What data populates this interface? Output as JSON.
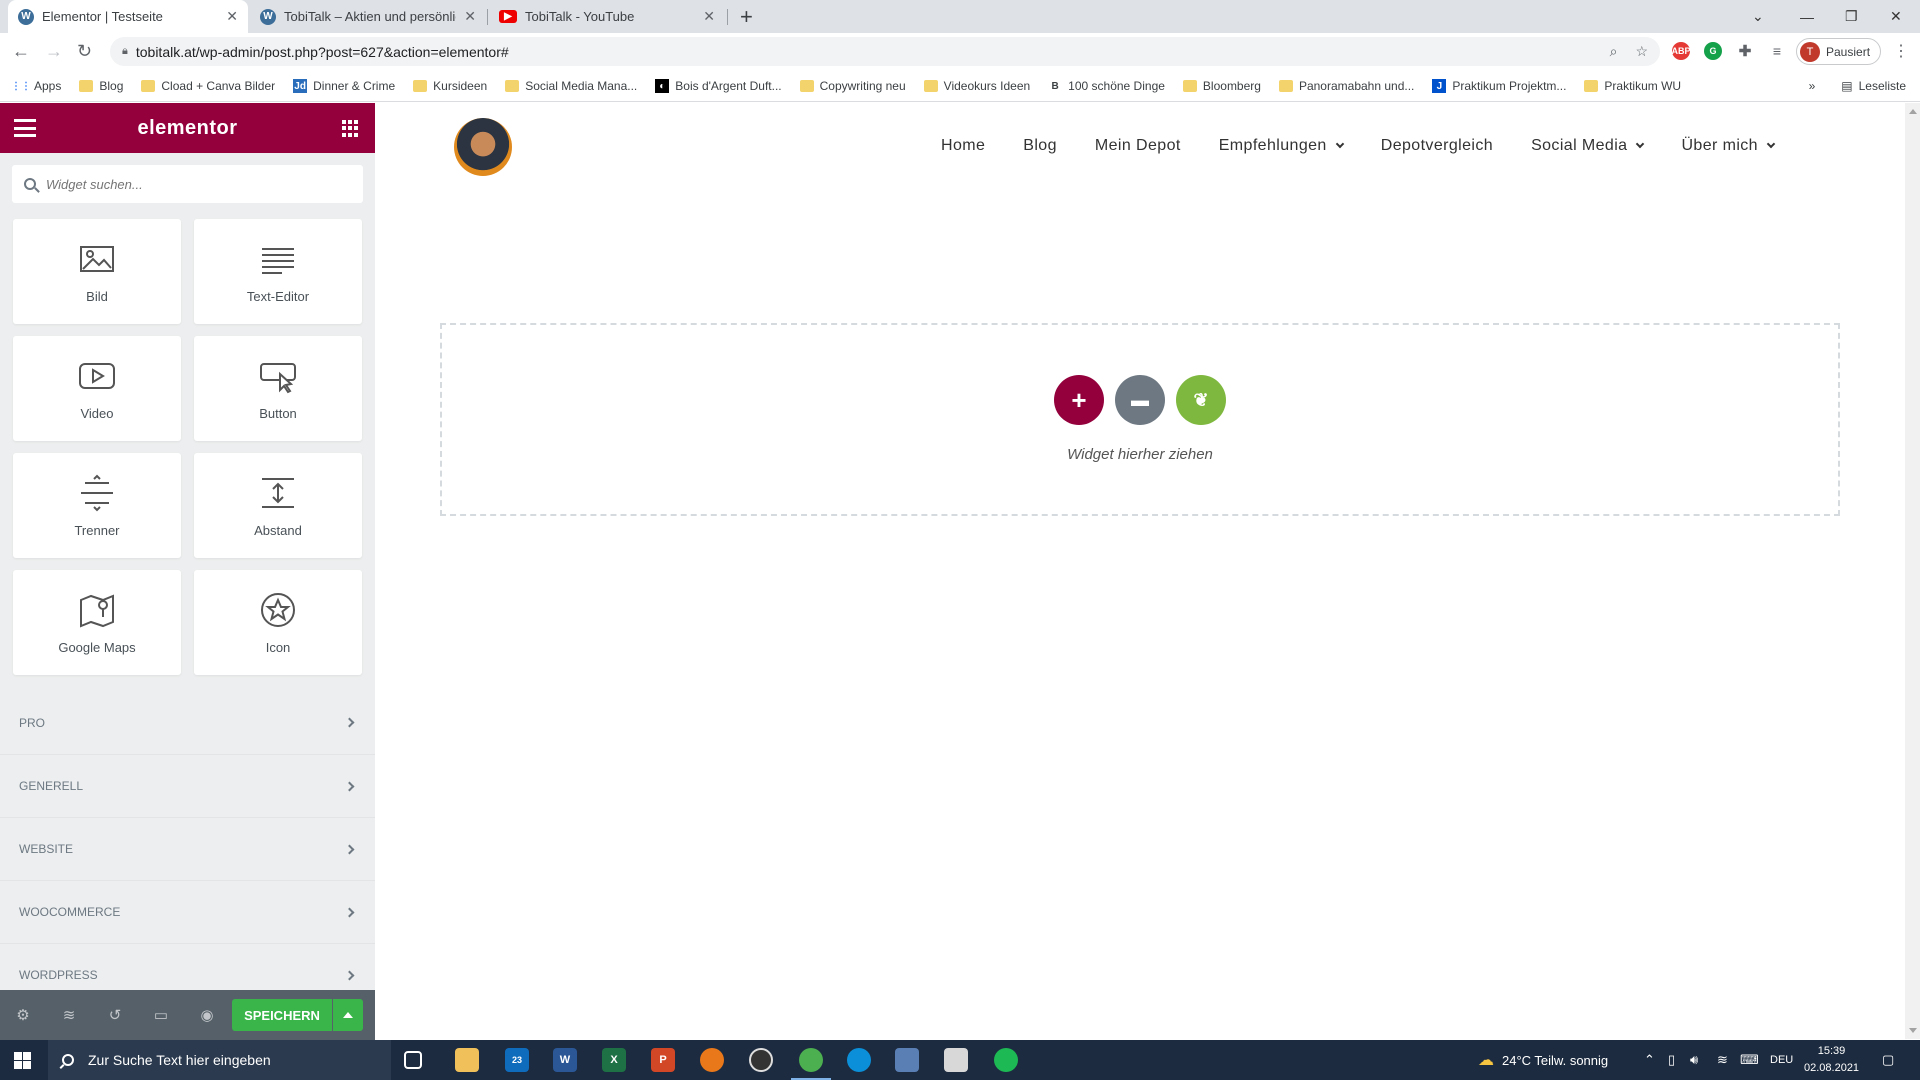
{
  "browser": {
    "tabs": [
      {
        "title": "Elementor | Testseite",
        "icon": "wordpress-icon"
      },
      {
        "title": "TobiTalk – Aktien und persönliche",
        "icon": "wordpress-icon"
      },
      {
        "title": "TobiTalk - YouTube",
        "icon": "youtube-icon"
      }
    ],
    "url": "tobitalk.at/wp-admin/post.php?post=627&action=elementor#",
    "profile_initial": "T",
    "profile_label": "Pausiert",
    "bookmarks": [
      "Apps",
      "Blog",
      "Cload + Canva Bilder",
      "Dinner & Crime",
      "Kursideen",
      "Social Media Mana...",
      "Bois d'Argent Duft...",
      "Copywriting neu",
      "Videokurs Ideen",
      "100 schöne Dinge",
      "Bloomberg",
      "Panoramabahn und...",
      "Praktikum Projektm...",
      "Praktikum WU"
    ],
    "reading_list": "Leseliste"
  },
  "panel": {
    "brand": "elementor",
    "search_placeholder": "Widget suchen...",
    "widgets": [
      {
        "label": "Bild",
        "icon": "image-icon"
      },
      {
        "label": "Text-Editor",
        "icon": "text-editor-icon"
      },
      {
        "label": "Video",
        "icon": "video-icon"
      },
      {
        "label": "Button",
        "icon": "button-icon"
      },
      {
        "label": "Trenner",
        "icon": "divider-icon"
      },
      {
        "label": "Abstand",
        "icon": "spacer-icon"
      },
      {
        "label": "Google Maps",
        "icon": "map-icon"
      },
      {
        "label": "Icon",
        "icon": "star-icon"
      }
    ],
    "categories": [
      "PRO",
      "GENERELL",
      "WEBSITE",
      "WOOCOMMERCE",
      "WORDPRESS"
    ],
    "save_label": "SPEICHERN",
    "accent": "#93003c",
    "save_color": "#39b54a"
  },
  "preview": {
    "menu": [
      {
        "label": "Home",
        "dropdown": false
      },
      {
        "label": "Blog",
        "dropdown": false
      },
      {
        "label": "Mein Depot",
        "dropdown": false
      },
      {
        "label": "Empfehlungen",
        "dropdown": true
      },
      {
        "label": "Depotvergleich",
        "dropdown": false
      },
      {
        "label": "Social Media",
        "dropdown": true
      },
      {
        "label": "Über mich",
        "dropdown": true
      }
    ],
    "dropzone_text": "Widget hierher ziehen",
    "add_button_color": "#93003c",
    "template_button_color": "#6d7882",
    "envato_button_color": "#7fb83f"
  },
  "taskbar": {
    "search_placeholder": "Zur Suche Text hier eingeben",
    "mail_badge": "23",
    "weather": "24°C  Teilw. sonnig",
    "language": "DEU",
    "time": "15:39",
    "date": "02.08.2021"
  }
}
